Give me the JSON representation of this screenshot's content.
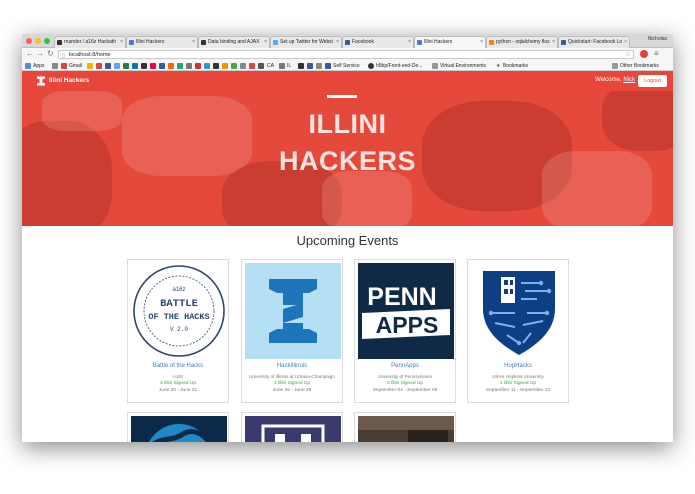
{
  "browser": {
    "tabs": [
      {
        "label": "rnandor / a16z Hackath"
      },
      {
        "label": "Illini Hackers"
      },
      {
        "label": "Data binding and AJAX"
      },
      {
        "label": "Set up Twitter for Websi"
      },
      {
        "label": "Facebook"
      },
      {
        "label": "Illini Hackers"
      },
      {
        "label": "python - sqlalchemy flus"
      },
      {
        "label": "Quickstart: Facebook Lo"
      }
    ],
    "profile_name": "Nicholas",
    "url": "localhost:8/home",
    "bookmarks": {
      "apps": "Apps",
      "gmail": "Gmail",
      "ca": "CA",
      "il": "IL",
      "self_service": "Self Service",
      "h5bp": "h5bp/Front-end-De...",
      "virtual_env": "Virtual Environments",
      "bookmarks": "Bookmarks",
      "other": "Other Bookmarks"
    }
  },
  "navbar": {
    "brand": "Illini Hackers",
    "welcome_prefix": "Welcome,",
    "user": "Nick",
    "logout": "Logout"
  },
  "hero": {
    "line1": "ILLINI",
    "line2": "HACKERS"
  },
  "events_title": "Upcoming Events",
  "events": [
    {
      "name": "Battle of the Hacks",
      "org": "A16z",
      "signed": "3 Illini Signed Up",
      "dates": "June 20 - June 21",
      "logo_lines": [
        "a16z",
        "BATTLE",
        "OF THE HACKS",
        "V 2.0"
      ]
    },
    {
      "name": "HackIllinois",
      "org": "University of Illinois at Urbana-Champaign",
      "signed": "1 Illini Signed Up",
      "dates": "June 26 - June 28"
    },
    {
      "name": "PennApps",
      "org": "University of Pennsylvania",
      "signed": "0 Illini Signed Up",
      "dates": "September 04 - September 06",
      "logo_lines": [
        "PENN",
        "APPS"
      ]
    },
    {
      "name": "HopHacks",
      "org": "Johns Hopkins University",
      "signed": "1 Illini Signed Up",
      "dates": "September 11 - September 13"
    }
  ],
  "colors": {
    "brand_red": "#e8463a",
    "link_blue": "#3d7fbf",
    "signed_green": "#3aa53a"
  }
}
